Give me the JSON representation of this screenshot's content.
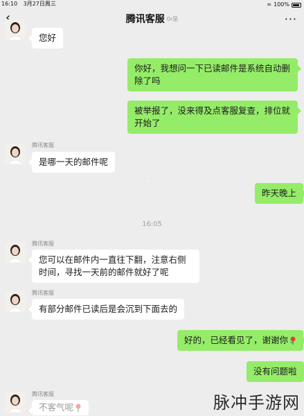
{
  "status_bar": {
    "time": "16:10",
    "date": "3月27日周三",
    "battery": "100%"
  },
  "header": {
    "title": "腾讯客服",
    "subtitle": "0r是"
  },
  "messages": [
    {
      "side": "left",
      "text": "您好"
    },
    {
      "side": "right",
      "text": "你好，我想问一下已读邮件是系统自动删除了吗"
    },
    {
      "side": "right",
      "text": "被举报了，没来得及点客服复查，排位就开始了"
    },
    {
      "side": "left",
      "sender": "腾讯客服",
      "text": "是哪一天的邮件呢"
    },
    {
      "side": "right",
      "text": "昨天晚上"
    },
    {
      "side": "left",
      "sender": "腾讯客服",
      "text": "您可以在邮件内一直往下翻，注意右侧时间，寻找一天前的邮件就好了呢"
    },
    {
      "side": "left",
      "sender": "腾讯客服",
      "text": "有部分邮件已读后是会沉到下面去的"
    },
    {
      "side": "right",
      "text": "好的，已经看见了，谢谢你"
    },
    {
      "side": "right",
      "text": "没有问题啦"
    },
    {
      "side": "left",
      "sender": "腾讯客服",
      "text": "不客气呢"
    }
  ],
  "timestamp": "16:05",
  "watermark": "脉冲手游网",
  "colors": {
    "background": "#ededed",
    "bubble_right": "#95ec69",
    "bubble_left": "#ffffff"
  },
  "icons": [
    "back-arrow-icon",
    "more-icon",
    "wifi-icon",
    "battery-icon",
    "rose-emoji-icon"
  ]
}
